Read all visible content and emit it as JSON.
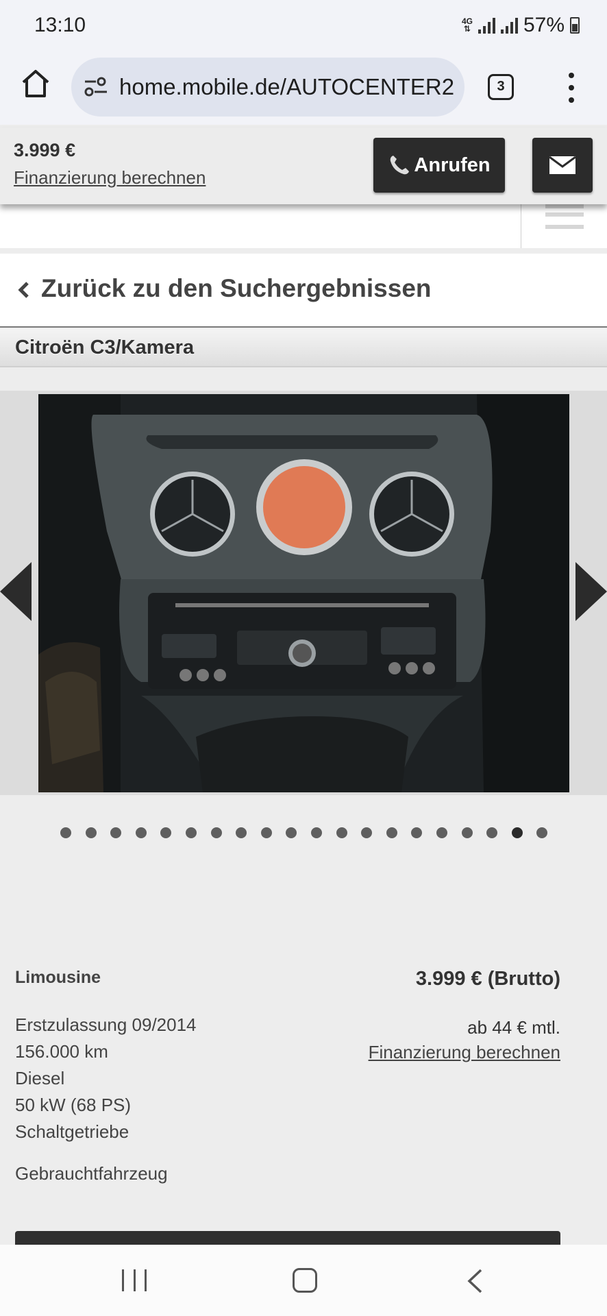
{
  "status_bar": {
    "time": "13:10",
    "network": "4G",
    "battery": "57%"
  },
  "browser": {
    "url": "home.mobile.de/AUTOCENTER2",
    "tab_count": "3"
  },
  "sticky_header": {
    "price": "3.999 €",
    "financing_link": "Finanzierung berechnen",
    "call_label": "Anrufen"
  },
  "back_link": "Zurück zu den Suchergebnissen",
  "listing_title": "Citroën C3/Kamera",
  "gallery": {
    "total_images": 20,
    "active_index": 18
  },
  "details": {
    "body_type": "Limousine",
    "price": "3.999 € (Brutto)",
    "first_registration": "Erstzulassung 09/2014",
    "mileage": "156.000 km",
    "fuel": "Diesel",
    "power": "50 kW (68 PS)",
    "transmission": "Schaltgetriebe",
    "condition": "Gebrauchtfahrzeug",
    "monthly_rate": "ab 44 € mtl.",
    "financing_link": "Finanzierung berechnen"
  },
  "colors": {
    "button_dark": "#2b2b2b",
    "page_bg": "#ededed",
    "browser_bg": "#f2f3f8",
    "url_pill": "#dfe3ee"
  }
}
